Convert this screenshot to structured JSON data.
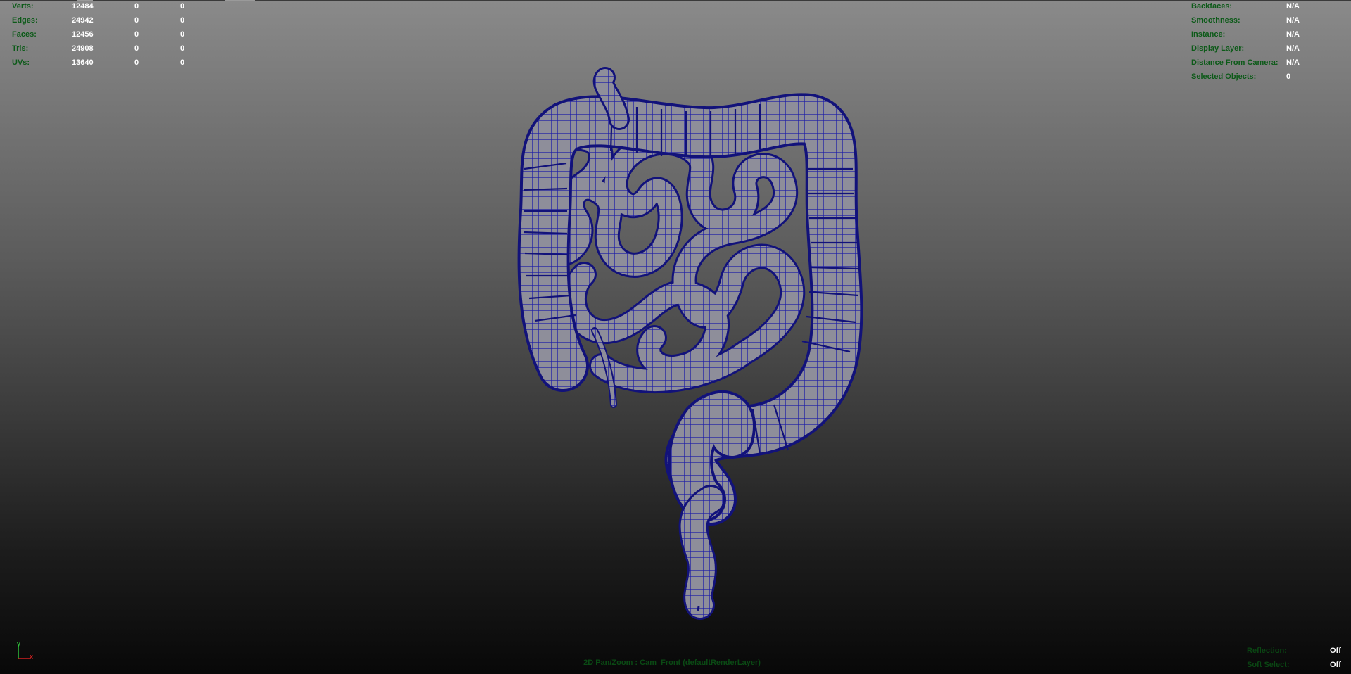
{
  "poly_count": {
    "rows": [
      {
        "label": "Verts:",
        "values": [
          "12484",
          "0",
          "0"
        ]
      },
      {
        "label": "Edges:",
        "values": [
          "24942",
          "0",
          "0"
        ]
      },
      {
        "label": "Faces:",
        "values": [
          "12456",
          "0",
          "0"
        ]
      },
      {
        "label": "Tris:",
        "values": [
          "24908",
          "0",
          "0"
        ]
      },
      {
        "label": "UVs:",
        "values": [
          "13640",
          "0",
          "0"
        ]
      }
    ]
  },
  "object_details": {
    "rows": [
      {
        "label": "Backfaces:",
        "value": "N/A"
      },
      {
        "label": "Smoothness:",
        "value": "N/A"
      },
      {
        "label": "Instance:",
        "value": "N/A"
      },
      {
        "label": "Display Layer:",
        "value": "N/A"
      },
      {
        "label": "Distance From Camera:",
        "value": "N/A"
      },
      {
        "label": "Selected Objects:",
        "value": "0"
      }
    ]
  },
  "viewport_status": {
    "rows": [
      {
        "label": "Reflection:",
        "value": "Off"
      },
      {
        "label": "Soft Select:",
        "value": "Off"
      }
    ]
  },
  "camera_label": "2D Pan/Zoom : Cam_Front (defaultRenderLayer)",
  "axis_gizmo": {
    "y_label": "y",
    "x_label": "x"
  },
  "colors": {
    "hud_label": "#0c5a18",
    "hud_value": "#ffffff",
    "wireframe": "#1a1a9a",
    "mesh_fill": "#8c8c98",
    "axis_y": "#2fbf3a",
    "axis_x": "#d02020"
  },
  "icons": {
    "axis": "xy-axis-gizmo-icon"
  }
}
